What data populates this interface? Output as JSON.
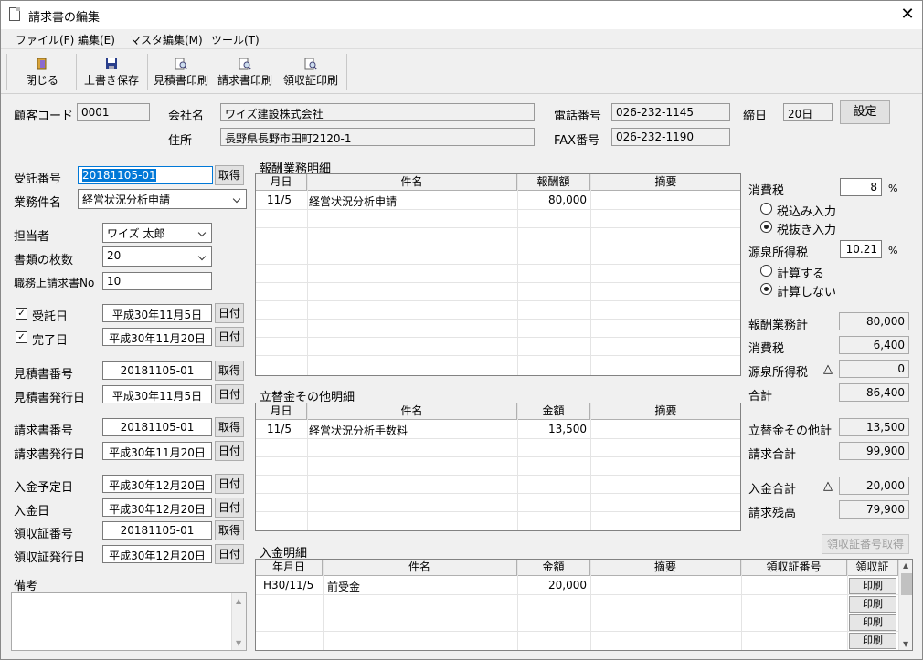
{
  "window": {
    "title": "請求書の編集",
    "close": "✕"
  },
  "menu": [
    "ファイル(F)",
    "編集(E)",
    "マスタ編集(M)",
    "ツール(T)"
  ],
  "toolbar": {
    "close": "閉じる",
    "save": "上書き保存",
    "estimate_print": "見積書印刷",
    "invoice_print": "請求書印刷",
    "receipt_print": "領収証印刷"
  },
  "header": {
    "customer_code_label": "顧客コード",
    "customer_code": "0001",
    "company_label": "会社名",
    "company": "ワイズ建設株式会社",
    "address_label": "住所",
    "address": "長野県長野市田町2120-1",
    "phone_label": "電話番号",
    "phone": "026-232-1145",
    "fax_label": "FAX番号",
    "fax": "026-232-1190",
    "cutoff_label": "締日",
    "cutoff": "20日",
    "settings_button": "設定"
  },
  "left": {
    "order_no_label": "受託番号",
    "order_no": "20181105-01",
    "get": "取得",
    "task_label": "業務件名",
    "task": "経営状況分析申請",
    "staff_label": "担当者",
    "staff": "ワイズ 太郎",
    "docs_label": "書類の枚数",
    "docs": "20",
    "duty_label": "職務上請求書No",
    "duty": "10",
    "received_label": "受託日",
    "received": "平成30年11月5日",
    "received_checked": true,
    "completed_label": "完了日",
    "completed": "平成30年11月20日",
    "completed_checked": true,
    "date_button": "日付",
    "estimate_no_label": "見積書番号",
    "estimate_no": "20181105-01",
    "estimate_date_label": "見積書発行日",
    "estimate_date": "平成30年11月5日",
    "invoice_no_label": "請求書番号",
    "invoice_no": "20181105-01",
    "invoice_date_label": "請求書発行日",
    "invoice_date": "平成30年11月20日",
    "due_label": "入金予定日",
    "due": "平成30年12月20日",
    "paid_label": "入金日",
    "paid": "平成30年12月20日",
    "receipt_no_label": "領収証番号",
    "receipt_no": "20181105-01",
    "receipt_date_label": "領収証発行日",
    "receipt_date": "平成30年12月20日",
    "memo_label": "備考"
  },
  "fee_grid": {
    "title": "報酬業務明細",
    "headers": [
      "月日",
      "件名",
      "報酬額",
      "摘要"
    ],
    "rows": [
      [
        "11/5",
        "経営状況分析申請",
        "80,000",
        ""
      ]
    ]
  },
  "adv_grid": {
    "title": "立替金その他明細",
    "headers": [
      "月日",
      "件名",
      "金額",
      "摘要"
    ],
    "rows": [
      [
        "11/5",
        "経営状況分析手数料",
        "13,500",
        ""
      ]
    ]
  },
  "pay_grid": {
    "title": "入金明細",
    "headers": [
      "年月日",
      "件名",
      "金額",
      "摘要",
      "領収証番号",
      "領収証"
    ],
    "rows": [
      [
        "H30/11/5",
        "前受金",
        "20,000",
        "",
        ""
      ]
    ],
    "print": "印刷"
  },
  "right": {
    "tax_label": "消費税",
    "tax_rate": "8",
    "pct": "%",
    "tax_incl": "税込み入力",
    "tax_excl": "税抜き入力",
    "wht_label": "源泉所得税",
    "wht_rate": "10.21",
    "calc": "計算する",
    "nocalc": "計算しない",
    "fee_total_label": "報酬業務計",
    "fee_total": "80,000",
    "tax_amount_label": "消費税",
    "tax_amount": "6,400",
    "wht_amount_label": "源泉所得税",
    "wht_amount": "0",
    "triangle": "△",
    "subtotal_label": "合計",
    "subtotal": "86,400",
    "adv_total_label": "立替金その他計",
    "adv_total": "13,500",
    "invoice_total_label": "請求合計",
    "invoice_total": "99,900",
    "receipt_get": "領収証番号取得",
    "paid_total_label": "入金合計",
    "paid_total": "20,000",
    "balance_label": "請求残高",
    "balance": "79,900"
  }
}
